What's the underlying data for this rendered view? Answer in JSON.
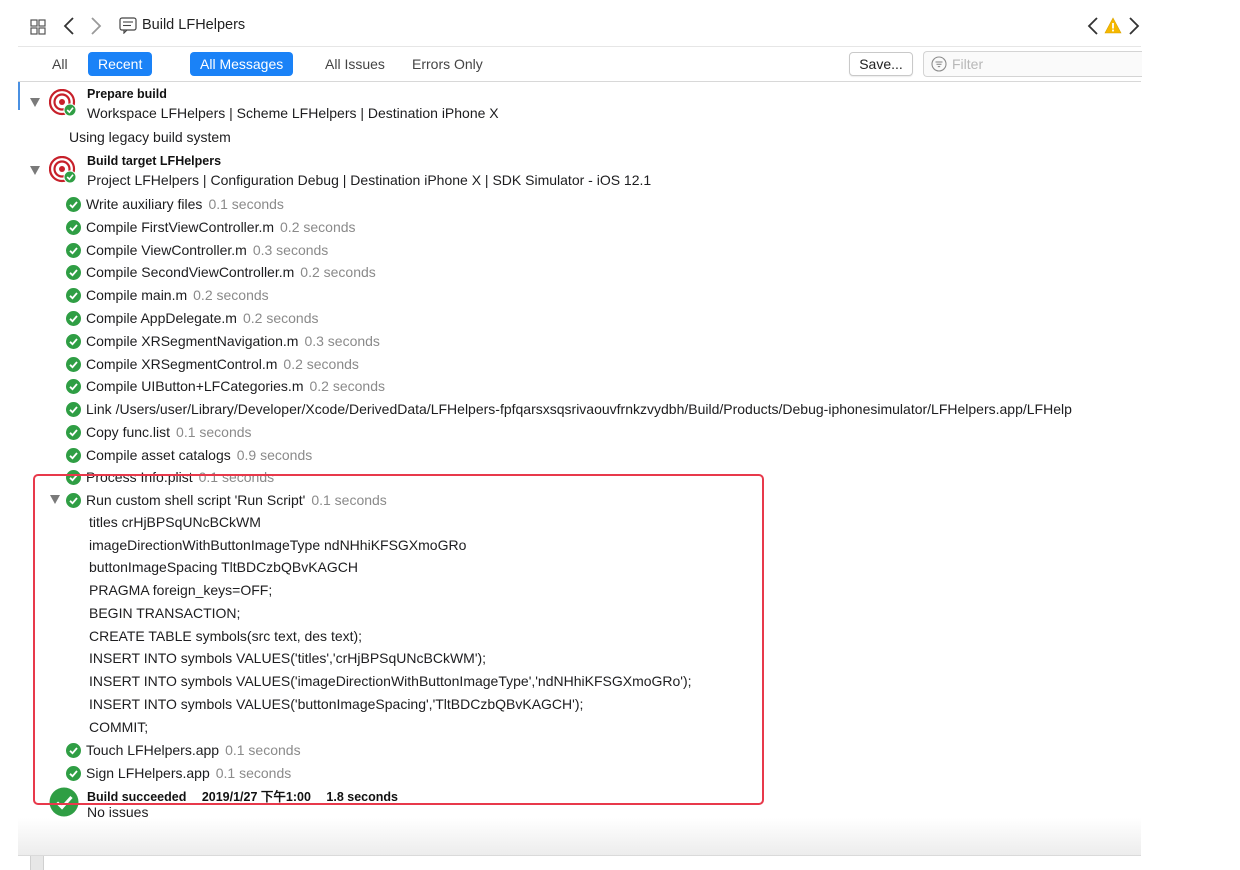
{
  "toolbar": {
    "title": "Build LFHelpers"
  },
  "filters": {
    "all": "All",
    "recent": "Recent",
    "all_messages": "All Messages",
    "all_issues": "All Issues",
    "errors_only": "Errors Only",
    "save": "Save...",
    "filter_placeholder": "Filter"
  },
  "colors": {
    "accent": "#1a82f7",
    "success": "#2f9e44",
    "highlight": "#e8394b",
    "warning": "#f5b800"
  },
  "prepare": {
    "title": "Prepare build",
    "subtitle": "Workspace LFHelpers | Scheme LFHelpers | Destination iPhone X",
    "note": "Using legacy build system"
  },
  "target": {
    "title": "Build target LFHelpers",
    "subtitle": "Project LFHelpers | Configuration Debug | Destination iPhone X | SDK Simulator - iOS 12.1"
  },
  "steps": [
    {
      "text": "Write auxiliary files",
      "duration": "0.1 seconds"
    },
    {
      "text": "Compile FirstViewController.m",
      "duration": "0.2 seconds"
    },
    {
      "text": "Compile ViewController.m",
      "duration": "0.3 seconds"
    },
    {
      "text": "Compile SecondViewController.m",
      "duration": "0.2 seconds"
    },
    {
      "text": "Compile main.m",
      "duration": "0.2 seconds"
    },
    {
      "text": "Compile AppDelegate.m",
      "duration": "0.2 seconds"
    },
    {
      "text": "Compile XRSegmentNavigation.m",
      "duration": "0.3 seconds"
    },
    {
      "text": "Compile XRSegmentControl.m",
      "duration": "0.2 seconds"
    },
    {
      "text": "Compile UIButton+LFCategories.m",
      "duration": "0.2 seconds"
    },
    {
      "text": "Link /Users/user/Library/Developer/Xcode/DerivedData/LFHelpers-fpfqarsxsqsrivaouvfrnkzvydbh/Build/Products/Debug-iphonesimulator/LFHelpers.app/LFHelp",
      "duration": ""
    },
    {
      "text": "Copy func.list",
      "duration": "0.1 seconds"
    },
    {
      "text": "Compile asset catalogs",
      "duration": "0.9 seconds"
    },
    {
      "text": "Process Info.plist",
      "duration": "0.1 seconds"
    }
  ],
  "script": {
    "text": "Run custom shell script 'Run Script'",
    "duration": "0.1 seconds",
    "output": [
      "titles crHjBPSqUNcBCkWM",
      "imageDirectionWithButtonImageType ndNHhiKFSGXmoGRo",
      "buttonImageSpacing TltBDCzbQBvKAGCH",
      "PRAGMA foreign_keys=OFF;",
      "BEGIN TRANSACTION;",
      "CREATE TABLE symbols(src text, des text);",
      "INSERT INTO symbols VALUES('titles','crHjBPSqUNcBCkWM');",
      "INSERT INTO symbols VALUES('imageDirectionWithButtonImageType','ndNHhiKFSGXmoGRo');",
      "INSERT INTO symbols VALUES('buttonImageSpacing','TltBDCzbQBvKAGCH');",
      "COMMIT;"
    ]
  },
  "final_steps": [
    {
      "text": "Touch LFHelpers.app",
      "duration": "0.1 seconds"
    },
    {
      "text": "Sign LFHelpers.app",
      "duration": "0.1 seconds"
    }
  ],
  "result": {
    "status": "Build succeeded",
    "timestamp": "2019/1/27 下午1:00",
    "duration": "1.8 seconds",
    "issues": "No issues"
  }
}
